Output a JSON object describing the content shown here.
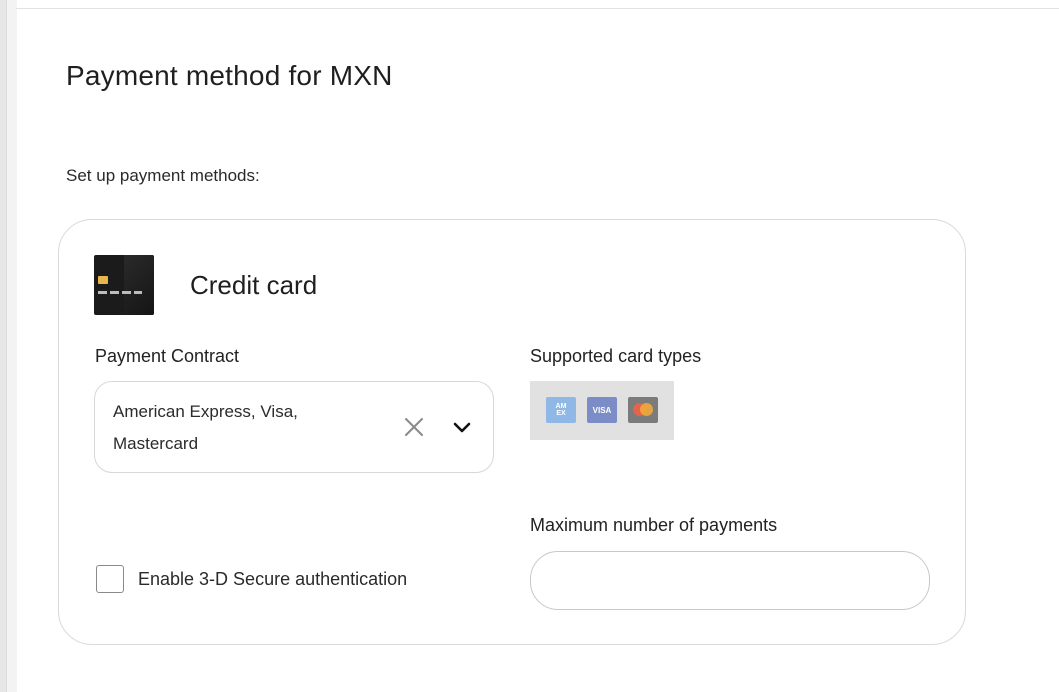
{
  "page": {
    "title": "Payment method for MXN",
    "subtitle": "Set up payment methods:"
  },
  "method": {
    "icon": "credit-card-icon",
    "title": "Credit card"
  },
  "payment_contract": {
    "label": "Payment Contract",
    "value_line1": "American Express, Visa,",
    "value_line2": "Mastercard",
    "clear_icon": "close-icon",
    "dropdown_icon": "chevron-down-icon"
  },
  "supported_card_types": {
    "label": "Supported card types",
    "cards": [
      {
        "name": "American Express",
        "icon": "amex-card-icon",
        "mark": "AM EX",
        "color": "#8fb8e6"
      },
      {
        "name": "Visa",
        "icon": "visa-card-icon",
        "mark": "VISA",
        "color": "#7c8cc6"
      },
      {
        "name": "Mastercard",
        "icon": "mastercard-icon",
        "mark": "",
        "color": "#7b7b7b"
      }
    ]
  },
  "three_d_secure": {
    "label": "Enable 3-D Secure authentication",
    "checked": false
  },
  "max_payments": {
    "label": "Maximum number of payments",
    "value": "",
    "placeholder": ""
  }
}
